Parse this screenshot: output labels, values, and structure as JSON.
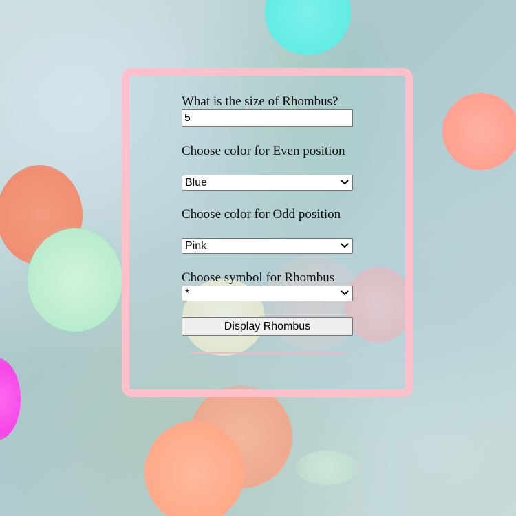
{
  "form": {
    "size_label": "What is the size of Rhombus?",
    "size_value": "5",
    "even_label": "Choose color for Even position",
    "even_selected": "Blue",
    "odd_label": "Choose color for Odd position",
    "odd_selected": "Pink",
    "symbol_label": "Choose symbol for Rhombus",
    "symbol_selected": "*",
    "submit_label": "Display Rhombus"
  },
  "colors": {
    "card_border": "#ffc0cb",
    "divider": "#f0b9c3"
  },
  "icons": {
    "dropdown": "chevron-down-icon"
  }
}
